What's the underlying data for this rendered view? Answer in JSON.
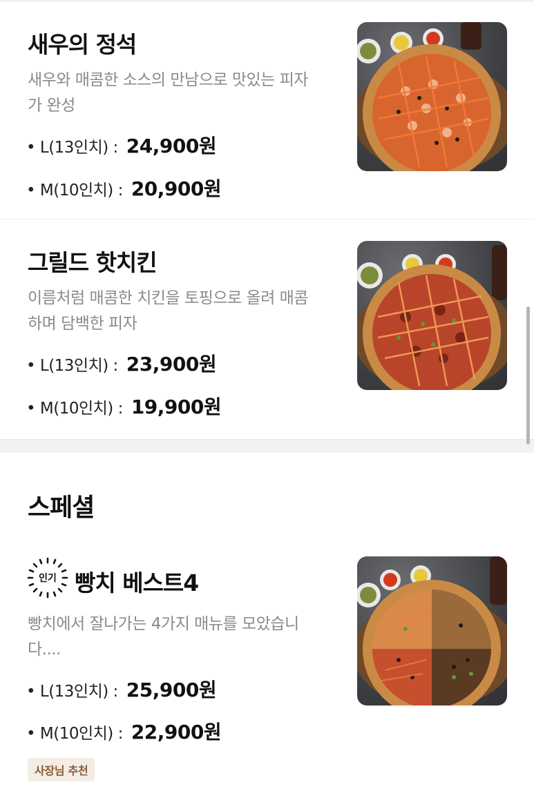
{
  "items": [
    {
      "name": "새우의 정석",
      "desc_line1": "새우와 매콤한 소스의 만남으로 맛있는 피자",
      "desc_line2": "가 완성",
      "price_l_label": "• L(13인치) :",
      "price_l": "24,900원",
      "price_m_label": "• M(10인치) :",
      "price_m": "20,900원"
    },
    {
      "name": "그릴드 핫치킨",
      "desc_line1": "이름처럼 매콤한 치킨을 토핑으로 올려 매콤",
      "desc_line2": "하며 담백한 피자",
      "price_l_label": "• L(13인치) :",
      "price_l": "23,900원",
      "price_m_label": "• M(10인치) :",
      "price_m": "19,900원"
    }
  ],
  "special_section": {
    "title": "스페셜",
    "item": {
      "badge": "인기",
      "name": "빵치 베스트4",
      "desc_line1": "빵치에서 잘나가는 4가지 매뉴를 모았습니",
      "desc_line2": "다....",
      "price_l_label": "• L(13인치) :",
      "price_l": "25,900원",
      "price_m_label": "• M(10인치) :",
      "price_m": "22,900원",
      "tag": "사장님 추천"
    }
  },
  "icons": [
    "pizza-photo",
    "popular-badge-icon"
  ],
  "colors": {
    "accent_tag_bg": "#f3ede6",
    "accent_tag_text": "#8a5a34",
    "desc_gray": "#8a8a8e"
  }
}
